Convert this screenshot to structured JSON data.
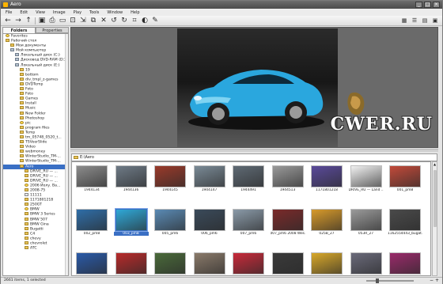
{
  "window": {
    "title": "Aero",
    "controls": [
      "_",
      "□",
      "×"
    ]
  },
  "menu": [
    "File",
    "Edit",
    "View",
    "Image",
    "Play",
    "Tools",
    "Window",
    "Help"
  ],
  "left_tabs": [
    {
      "label": "Folders",
      "active": true
    },
    {
      "label": "Properties",
      "active": false
    }
  ],
  "tree": [
    {
      "label": "Favorites",
      "indent": 0,
      "icon": "star-icon"
    },
    {
      "label": "Рабочий стол",
      "indent": 0,
      "icon": "folder-icon"
    },
    {
      "label": "Мои документы",
      "indent": 1,
      "icon": "folder-icon"
    },
    {
      "label": "Мой компьютер",
      "indent": 1,
      "icon": "computer-icon"
    },
    {
      "label": "Локальный диск (C:)",
      "indent": 2,
      "icon": "drive-icon"
    },
    {
      "label": "Дисковод DVD-RAM (D:)",
      "indent": 2,
      "icon": "drive-icon"
    },
    {
      "label": "Локальный диск (E:)",
      "indent": 2,
      "icon": "drive-icon"
    },
    {
      "label": "19",
      "indent": 3,
      "icon": "folder-icon"
    },
    {
      "label": "bottom",
      "indent": 3,
      "icon": "folder-icon"
    },
    {
      "label": "div_tmpl_z-games",
      "indent": 3,
      "icon": "folder-icon"
    },
    {
      "label": "DVDTemp",
      "indent": 3,
      "icon": "folder-icon"
    },
    {
      "label": "Foto",
      "indent": 3,
      "icon": "folder-icon"
    },
    {
      "label": "Foto",
      "indent": 3,
      "icon": "folder-icon"
    },
    {
      "label": "Games",
      "indent": 3,
      "icon": "folder-icon"
    },
    {
      "label": "Install",
      "indent": 3,
      "icon": "folder-icon"
    },
    {
      "label": "Music",
      "indent": 3,
      "icon": "folder-icon"
    },
    {
      "label": "New Folder",
      "indent": 3,
      "icon": "folder-icon"
    },
    {
      "label": "Photoshop",
      "indent": 3,
      "icon": "folder-icon"
    },
    {
      "label": "pic",
      "indent": 3,
      "icon": "star-icon"
    },
    {
      "label": "program files",
      "indent": 3,
      "icon": "folder-icon"
    },
    {
      "label": "Temp",
      "indent": 3,
      "icon": "folder-icon"
    },
    {
      "label": "tm_05748_0520_t...",
      "indent": 3,
      "icon": "folder-icon"
    },
    {
      "label": "TSVeerSlide",
      "indent": 3,
      "icon": "folder-icon"
    },
    {
      "label": "Video",
      "indent": 3,
      "icon": "folder-icon"
    },
    {
      "label": "webmoney",
      "indent": 3,
      "icon": "folder-icon"
    },
    {
      "label": "WinterStudio_TM-...",
      "indent": 3,
      "icon": "folder-icon"
    },
    {
      "label": "WinterStudio_TM-...",
      "indent": 3,
      "icon": "folder-icon"
    },
    {
      "label": "Aero",
      "indent": 3,
      "icon": "folder-icon",
      "selected": true
    },
    {
      "label": "DRIVE_RU — ...",
      "indent": 4,
      "icon": "folder-icon"
    },
    {
      "label": "DRIVE_RU — ...",
      "indent": 4,
      "icon": "folder-icon"
    },
    {
      "label": "DRIVE_RU — ...",
      "indent": 4,
      "icon": "folder-icon"
    },
    {
      "label": "2006 Йолу. Ва...",
      "indent": 4,
      "icon": "star-icon"
    },
    {
      "label": "2008-75",
      "indent": 4,
      "icon": "folder-icon"
    },
    {
      "label": "11111",
      "indent": 4,
      "icon": "doc-icon"
    },
    {
      "label": "1171801218",
      "indent": 4,
      "icon": "folder-icon"
    },
    {
      "label": "250GT",
      "indent": 4,
      "icon": "folder-icon"
    },
    {
      "label": "BMW",
      "indent": 4,
      "icon": "star-icon"
    },
    {
      "label": "BMW 3 Series",
      "indent": 4,
      "icon": "folder-icon"
    },
    {
      "label": "BMW 507",
      "indent": 4,
      "icon": "folder-icon"
    },
    {
      "label": "BMW Gina",
      "indent": 4,
      "icon": "folder-icon"
    },
    {
      "label": "Bugatti",
      "indent": 4,
      "icon": "folder-icon"
    },
    {
      "label": "C4",
      "indent": 4,
      "icon": "folder-icon"
    },
    {
      "label": "chevy",
      "indent": 4,
      "icon": "folder-icon"
    },
    {
      "label": "chevrolet",
      "indent": 4,
      "icon": "folder-icon"
    },
    {
      "label": "ATC",
      "indent": 4,
      "icon": "folder-icon"
    }
  ],
  "path": "E:\\Aero",
  "logo_text": "CWER.RU",
  "thumbnails": [
    {
      "caption": "1944134",
      "color": "#8c8c8c"
    },
    {
      "caption": "1944136",
      "color": "#6e7a86"
    },
    {
      "caption": "1944145",
      "color": "#9a3a2a"
    },
    {
      "caption": "1944147",
      "color": "#7a8a96"
    },
    {
      "caption": "1944491",
      "color": "#5f6a74"
    },
    {
      "caption": "1944513",
      "color": "#9a9a9a"
    },
    {
      "caption": "1171801218",
      "color": "#5a4a9a"
    },
    {
      "caption": "DRIVE_RU — Land ...",
      "color": "#f1f1f1"
    },
    {
      "caption": "001_pm8",
      "color": "#c24a3a"
    },
    {
      "caption": "002_pm8",
      "color": "#2f6ea8"
    },
    {
      "caption": "003_pm8",
      "color": "#2fa8d8",
      "selected": true
    },
    {
      "caption": "005_pm6",
      "color": "#5a8ab4"
    },
    {
      "caption": "006_pm6",
      "color": "#3a4a5a"
    },
    {
      "caption": "007_pm6",
      "color": "#8a9aa8"
    },
    {
      "caption": "007_pm6 2008 Wes...",
      "color": "#7a2a2a"
    },
    {
      "caption": "025B_27",
      "color": "#d89a2a"
    },
    {
      "caption": "053R_27",
      "color": "#9a9a9a"
    },
    {
      "caption": "1162554443_bugat...",
      "color": "#4a4a4a"
    },
    {
      "caption": "",
      "color": "#2a5aa8"
    },
    {
      "caption": "",
      "color": "#b82a2a"
    },
    {
      "caption": "",
      "color": "#4a6a3a"
    },
    {
      "caption": "",
      "color": "#8a7a6a"
    },
    {
      "caption": "",
      "color": "#c82a3a"
    },
    {
      "caption": "",
      "color": "#3a3a3a"
    },
    {
      "caption": "",
      "color": "#d8a82a"
    },
    {
      "caption": "",
      "color": "#6a6a7a"
    },
    {
      "caption": "",
      "color": "#9a2a6a"
    }
  ],
  "status": {
    "text": "2661 items, 1 selected",
    "zoom_fraction": 0.2
  }
}
